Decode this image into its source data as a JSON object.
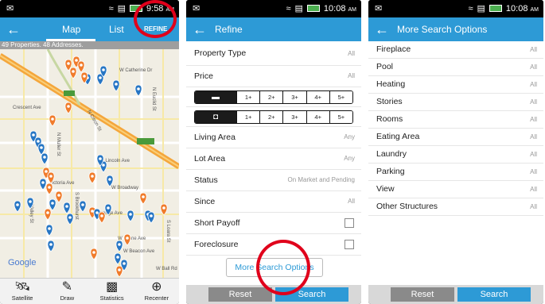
{
  "status": {
    "time1": "9:58",
    "time2": "10:08",
    "time3": "10:08",
    "ampm": "AM"
  },
  "phone1": {
    "tab_map": "Map",
    "tab_list": "List",
    "refine": "REFINE",
    "strip": "49 Properties. 48 Addresses.",
    "streets": [
      "W Catherine Dr",
      "Crescent Ave",
      "W Lincoln Ave",
      "W Broadway",
      "W Orange Ave",
      "W Crone Ave",
      "W Beacon Ave",
      "W Ball Rd",
      "N Euclid St",
      "N Muller St",
      "N Citron St",
      "S Valley St",
      "S Brookhurst",
      "S Loara St",
      "Victoria Ave"
    ],
    "map_logo": "Google",
    "tools": [
      {
        "label": "Satellite",
        "icon": "satellite-icon"
      },
      {
        "label": "Draw",
        "icon": "pen-icon"
      },
      {
        "label": "Statistics",
        "icon": "bar-chart-icon"
      },
      {
        "label": "Recenter",
        "icon": "crosshair-icon"
      }
    ]
  },
  "phone2": {
    "title": "Refine",
    "rows_top": [
      {
        "label": "Property Type",
        "value": "All"
      },
      {
        "label": "Price",
        "value": "All"
      }
    ],
    "bed_options": [
      "1+",
      "2+",
      "3+",
      "4+",
      "5+"
    ],
    "bath_options": [
      "1+",
      "2+",
      "3+",
      "4+",
      "5+"
    ],
    "rows_mid": [
      {
        "label": "Living Area",
        "value": "Any"
      },
      {
        "label": "Lot Area",
        "value": "Any"
      },
      {
        "label": "Status",
        "value": "On Market and Pending"
      },
      {
        "label": "Since",
        "value": "All"
      }
    ],
    "check_rows": [
      {
        "label": "Short Payoff"
      },
      {
        "label": "Foreclosure"
      }
    ],
    "more_button": "More Search Options",
    "reset": "Reset",
    "search": "Search"
  },
  "phone3": {
    "title": "More Search Options",
    "rows": [
      {
        "label": "Fireplace",
        "value": "All"
      },
      {
        "label": "Pool",
        "value": "All"
      },
      {
        "label": "Heating",
        "value": "All"
      },
      {
        "label": "Stories",
        "value": "All"
      },
      {
        "label": "Rooms",
        "value": "All"
      },
      {
        "label": "Eating Area",
        "value": "All"
      },
      {
        "label": "Laundry",
        "value": "All"
      },
      {
        "label": "Parking",
        "value": "All"
      },
      {
        "label": "View",
        "value": "All"
      },
      {
        "label": "Other Structures",
        "value": "All"
      }
    ],
    "reset": "Reset",
    "search": "Search"
  },
  "colors": {
    "accent": "#2d9ad6",
    "highlight": "#e0001b",
    "pin_orange": "#f07b2b",
    "pin_blue": "#2776c4"
  }
}
